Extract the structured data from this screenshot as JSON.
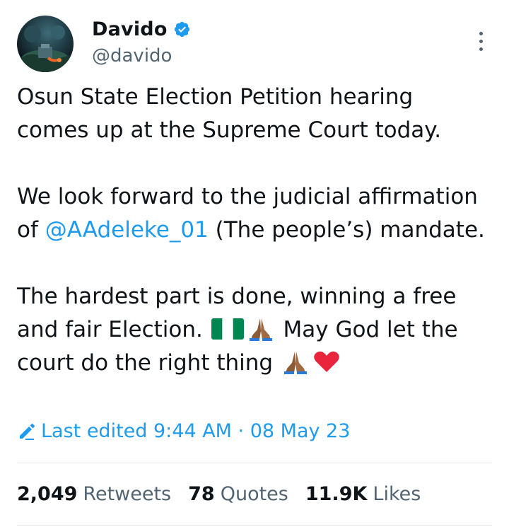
{
  "author": {
    "display_name": "Davido",
    "handle": "@davido"
  },
  "tweet": {
    "para1": "Osun State Election Petition hearing comes up at the Supreme Court today.",
    "para2_before": "We look forward to the judicial affirmation of ",
    "para2_mention": "@AAdeleke_01",
    "para2_after": " (The people’s) mandate.",
    "para3_part1": "The hardest part is done, winning a free and fair Election. ",
    "para3_part2": " May God let the court do the right thing ",
    "emojis": [
      "nigeria-flag",
      "folded-hands",
      "folded-hands",
      "red-heart"
    ]
  },
  "edited": {
    "label": "Last edited 9:44 AM · 08 May 23"
  },
  "stats": {
    "retweets_count": "2,049",
    "retweets_label": "Retweets",
    "quotes_count": "78",
    "quotes_label": "Quotes",
    "likes_count": "11.9K",
    "likes_label": "Likes"
  },
  "colors": {
    "accent": "#1d9bf0",
    "text": "#0f1419",
    "muted": "#536471",
    "divider": "#e4e8eb",
    "heart": "#e8253d"
  }
}
